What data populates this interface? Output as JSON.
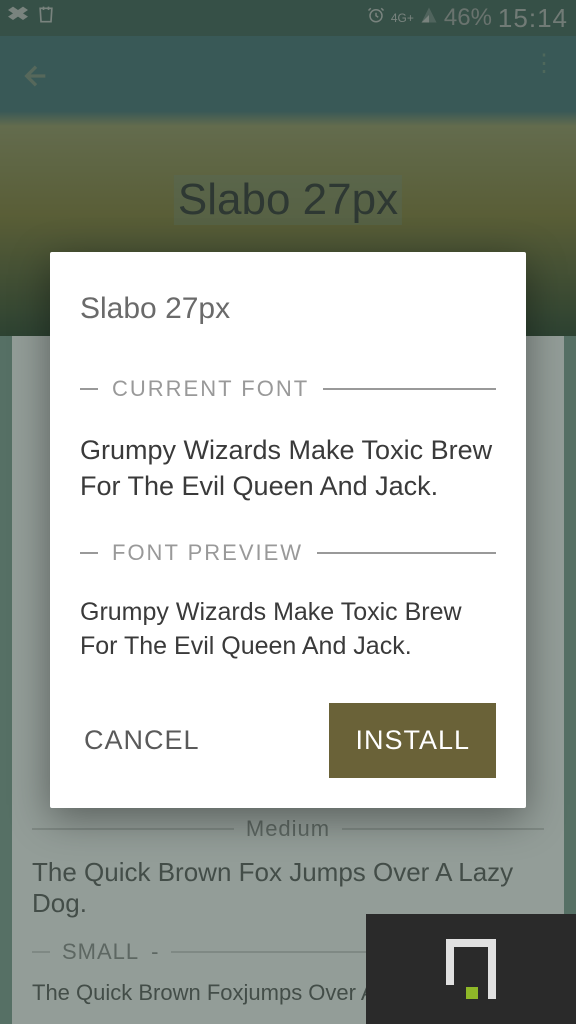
{
  "status": {
    "battery": "46%",
    "time": "15:14",
    "network": "4G+"
  },
  "page": {
    "title": "Slabo 27px",
    "sections": {
      "medium": {
        "label": "Medium",
        "sample": "The Quick Brown Fox Jumps Over A Lazy Dog."
      },
      "small": {
        "label": "SMALL",
        "sample": "The Quick Brown Foxjumps Over A Lazy"
      }
    }
  },
  "dialog": {
    "title": "Slabo 27px",
    "current_label": "CURRENT FONT",
    "current_sample": "Grumpy Wizards Make Toxic Brew For The Evil Queen And Jack.",
    "preview_label": "FONT PREVIEW",
    "preview_sample": "Grumpy Wizards Make Toxic Brew For The Evil Queen And Jack.",
    "cancel": "CANCEL",
    "install": "INSTALL"
  },
  "watermark": "PHONANDROID"
}
